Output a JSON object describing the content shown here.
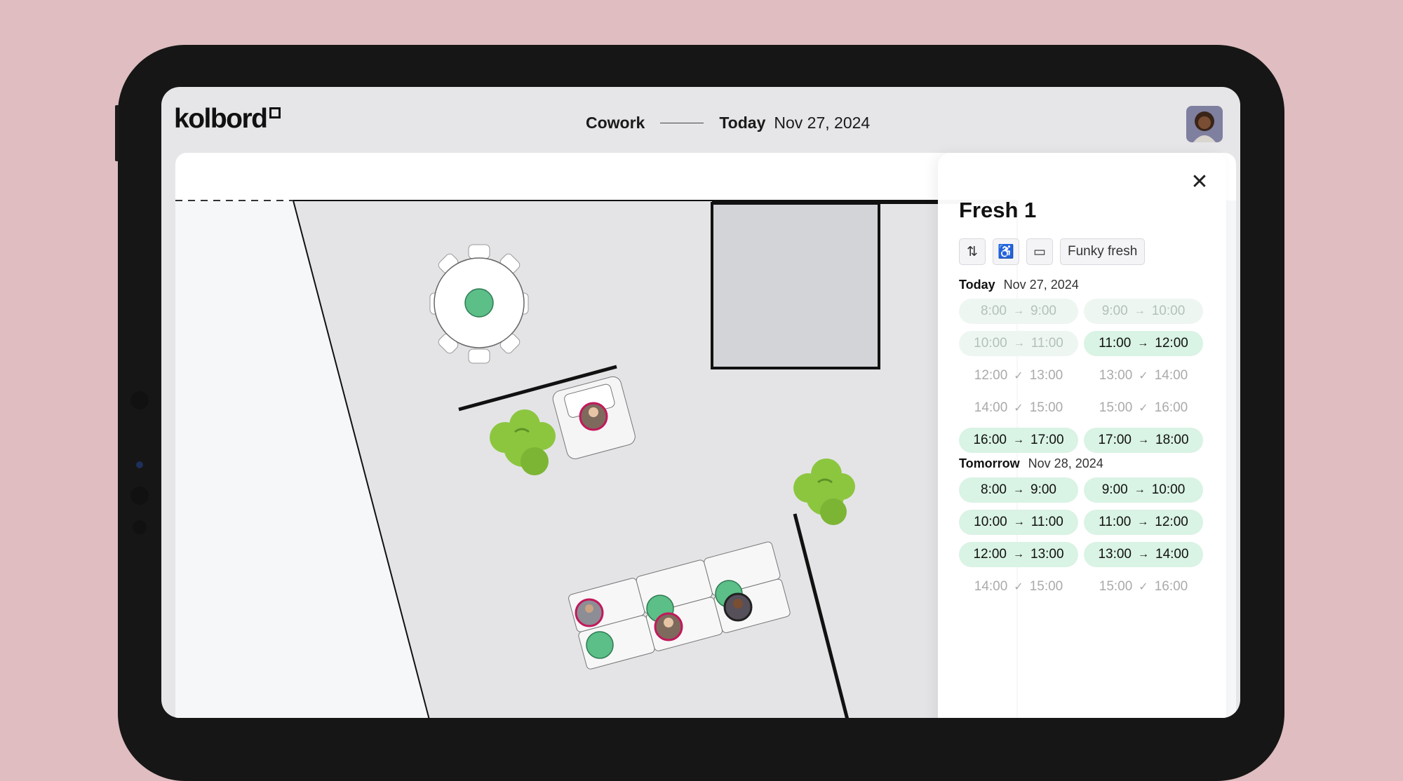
{
  "app": {
    "logo": "kolbord",
    "workspace": "Cowork",
    "day_label": "Today",
    "date": "Nov 27, 2024"
  },
  "colors": {
    "background": "#dfbdc0",
    "available_seat": "#5bbf87",
    "available_slot": "#d9f3e4",
    "plant": "#8cc63f"
  },
  "panel": {
    "title": "Fresh 1",
    "close_icon": "close-icon",
    "features": [
      {
        "icon": "height-adjustable-icon"
      },
      {
        "icon": "accessible-icon"
      },
      {
        "icon": "monitor-icon"
      },
      {
        "label": "Funky fresh"
      }
    ],
    "days": [
      {
        "label": "Today",
        "date": "Nov 27, 2024",
        "slots": [
          {
            "start": "8:00",
            "end": "9:00",
            "state": "past"
          },
          {
            "start": "9:00",
            "end": "10:00",
            "state": "past"
          },
          {
            "start": "10:00",
            "end": "11:00",
            "state": "past"
          },
          {
            "start": "11:00",
            "end": "12:00",
            "state": "free"
          },
          {
            "start": "12:00",
            "end": "13:00",
            "state": "taken"
          },
          {
            "start": "13:00",
            "end": "14:00",
            "state": "taken"
          },
          {
            "start": "14:00",
            "end": "15:00",
            "state": "taken"
          },
          {
            "start": "15:00",
            "end": "16:00",
            "state": "taken"
          },
          {
            "start": "16:00",
            "end": "17:00",
            "state": "free"
          },
          {
            "start": "17:00",
            "end": "18:00",
            "state": "free"
          }
        ]
      },
      {
        "label": "Tomorrow",
        "date": "Nov 28, 2024",
        "slots": [
          {
            "start": "8:00",
            "end": "9:00",
            "state": "free"
          },
          {
            "start": "9:00",
            "end": "10:00",
            "state": "free"
          },
          {
            "start": "10:00",
            "end": "11:00",
            "state": "free"
          },
          {
            "start": "11:00",
            "end": "12:00",
            "state": "free"
          },
          {
            "start": "12:00",
            "end": "13:00",
            "state": "free"
          },
          {
            "start": "13:00",
            "end": "14:00",
            "state": "free"
          },
          {
            "start": "14:00",
            "end": "15:00",
            "state": "taken"
          },
          {
            "start": "15:00",
            "end": "16:00",
            "state": "taken"
          }
        ]
      }
    ]
  }
}
